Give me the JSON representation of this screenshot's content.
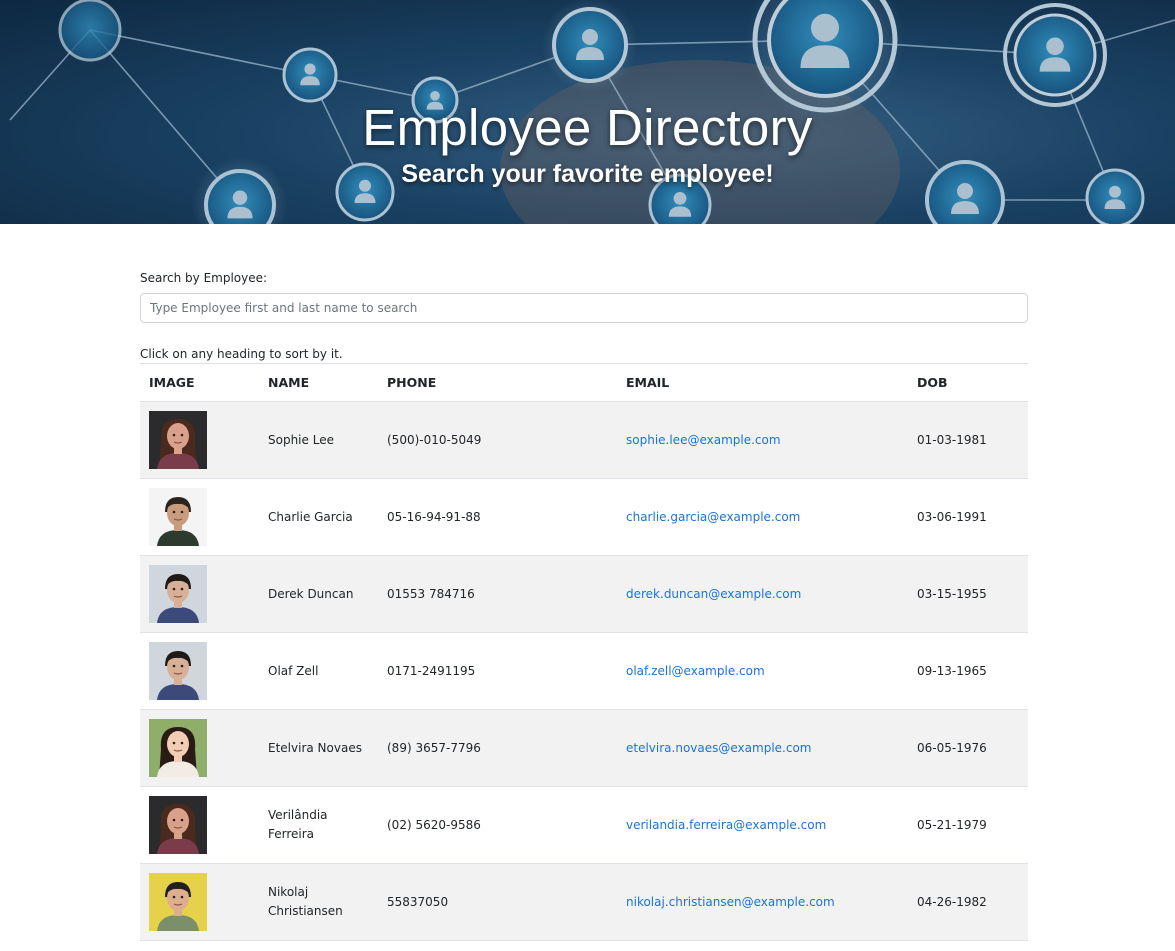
{
  "header": {
    "title": "Employee Directory",
    "subtitle": "Search your favorite employee!"
  },
  "search": {
    "label": "Search by Employee:",
    "placeholder": "Type Employee first and last name to search",
    "value": ""
  },
  "table": {
    "hint": "Click on any heading to sort by it.",
    "columns": [
      "IMAGE",
      "NAME",
      "PHONE",
      "EMAIL",
      "DOB"
    ],
    "rows": [
      {
        "name": "Sophie Lee",
        "phone": "(500)-010-5049",
        "email": "sophie.lee@example.com",
        "dob": "01-03-1981",
        "avatar": "avatar-woman-1"
      },
      {
        "name": "Charlie Garcia",
        "phone": "05-16-94-91-88",
        "email": "charlie.garcia@example.com",
        "dob": "03-06-1991",
        "avatar": "avatar-man-1"
      },
      {
        "name": "Derek Duncan",
        "phone": "01553 784716",
        "email": "derek.duncan@example.com",
        "dob": "03-15-1955",
        "avatar": "avatar-man-2"
      },
      {
        "name": "Olaf Zell",
        "phone": "0171-2491195",
        "email": "olaf.zell@example.com",
        "dob": "09-13-1965",
        "avatar": "avatar-man-2"
      },
      {
        "name": "Etelvira Novaes",
        "phone": "(89) 3657-7796",
        "email": "etelvira.novaes@example.com",
        "dob": "06-05-1976",
        "avatar": "avatar-woman-2"
      },
      {
        "name": "Verilândia Ferreira",
        "phone": "(02) 5620-9586",
        "email": "verilandia.ferreira@example.com",
        "dob": "05-21-1979",
        "avatar": "avatar-woman-1"
      },
      {
        "name": "Nikolaj Christiansen",
        "phone": "55837050",
        "email": "nikolaj.christiansen@example.com",
        "dob": "04-26-1982",
        "avatar": "avatar-man-3"
      }
    ]
  },
  "colors": {
    "link": "#1a73d9",
    "stripe": "#f2f2f2",
    "hero_dark": "#0e2a44",
    "hero_node": "#2b8fc4"
  }
}
